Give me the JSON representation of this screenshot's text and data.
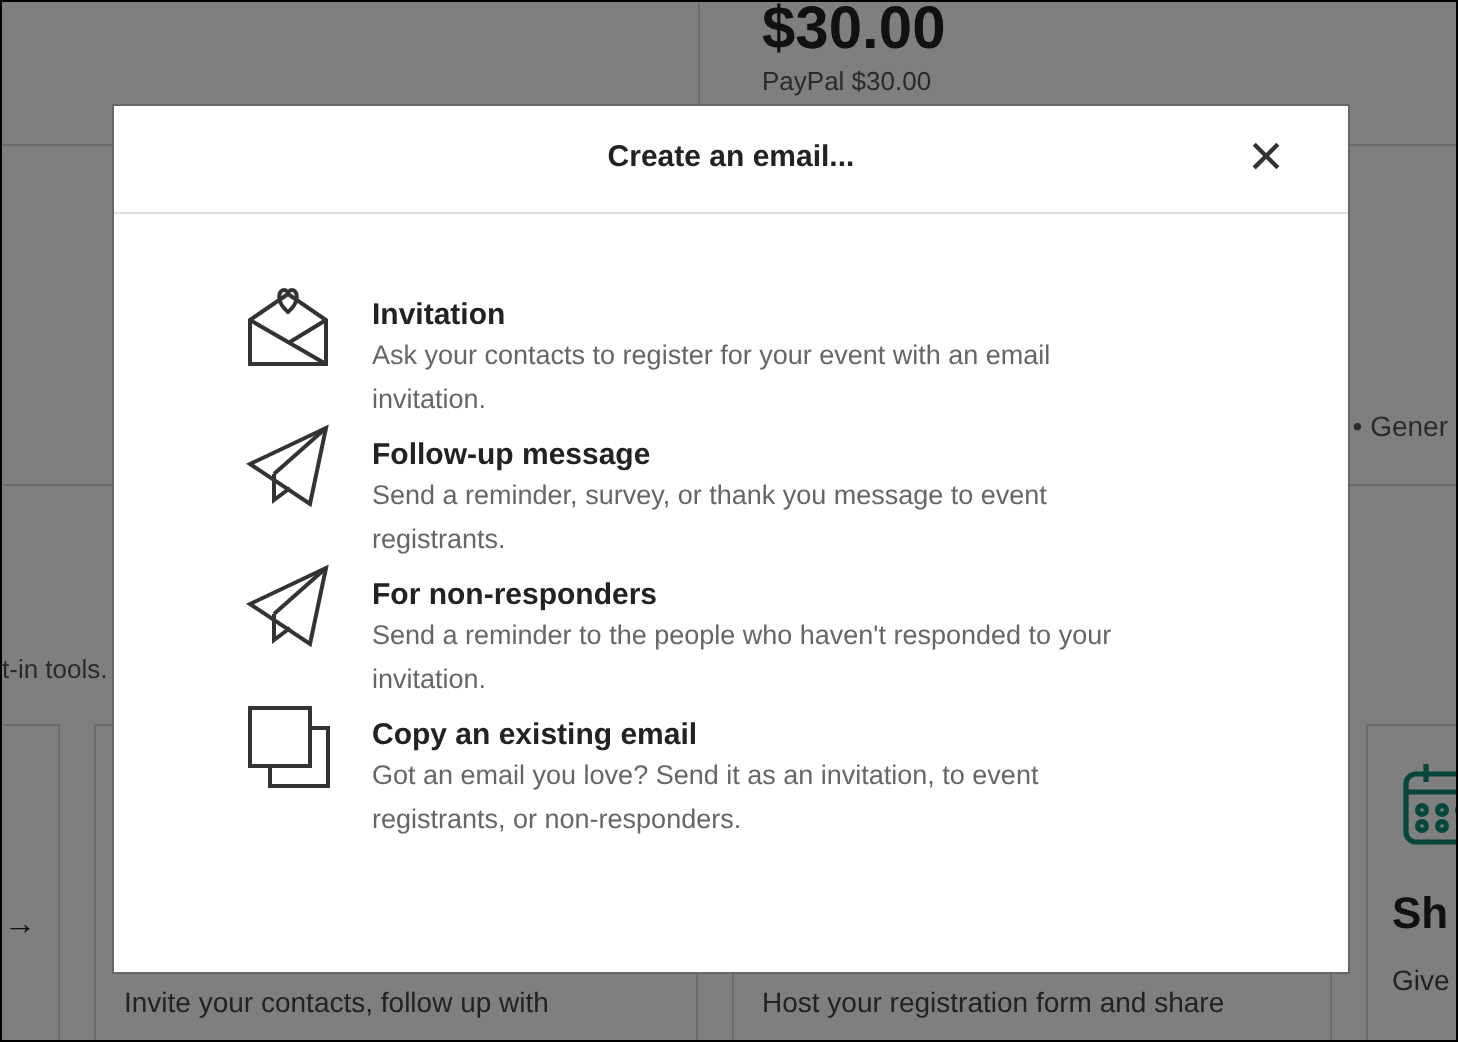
{
  "background": {
    "price": "$30.00",
    "payment": "PayPal $30.00",
    "meta": "• Gener",
    "intro": "t-in tools.",
    "cards": [
      {
        "kind": "arrow",
        "glyph": "→"
      },
      {
        "kind": "text",
        "text": "Invite your contacts, follow up with"
      },
      {
        "kind": "text",
        "text": "Host your registration form and share"
      },
      {
        "kind": "calendar",
        "title": "Sh",
        "text": "Give"
      }
    ]
  },
  "modal": {
    "title": "Create an email...",
    "close": "×",
    "options": [
      {
        "kind": "invitation",
        "title": "Invitation",
        "description": "Ask your contacts to register for your event with an email invitation."
      },
      {
        "kind": "follow-up",
        "title": "Follow-up message",
        "description": "Send a reminder, survey, or thank you message to event registrants."
      },
      {
        "kind": "non-responders",
        "title": "For non-responders",
        "description": "Send a reminder to the people who haven't responded to your invitation."
      },
      {
        "kind": "copy",
        "title": "Copy an existing email",
        "description": "Got an email you love? Send it as an invitation, to event registrants, or non-responders."
      }
    ]
  }
}
